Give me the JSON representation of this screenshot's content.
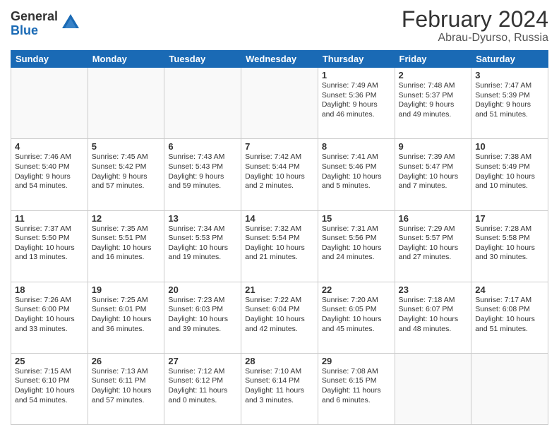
{
  "logo": {
    "general": "General",
    "blue": "Blue"
  },
  "header": {
    "title": "February 2024",
    "subtitle": "Abrau-Dyurso, Russia"
  },
  "weekdays": [
    "Sunday",
    "Monday",
    "Tuesday",
    "Wednesday",
    "Thursday",
    "Friday",
    "Saturday"
  ],
  "weeks": [
    [
      {
        "day": "",
        "lines": []
      },
      {
        "day": "",
        "lines": []
      },
      {
        "day": "",
        "lines": []
      },
      {
        "day": "",
        "lines": []
      },
      {
        "day": "1",
        "lines": [
          "Sunrise: 7:49 AM",
          "Sunset: 5:36 PM",
          "Daylight: 9 hours",
          "and 46 minutes."
        ]
      },
      {
        "day": "2",
        "lines": [
          "Sunrise: 7:48 AM",
          "Sunset: 5:37 PM",
          "Daylight: 9 hours",
          "and 49 minutes."
        ]
      },
      {
        "day": "3",
        "lines": [
          "Sunrise: 7:47 AM",
          "Sunset: 5:39 PM",
          "Daylight: 9 hours",
          "and 51 minutes."
        ]
      }
    ],
    [
      {
        "day": "4",
        "lines": [
          "Sunrise: 7:46 AM",
          "Sunset: 5:40 PM",
          "Daylight: 9 hours",
          "and 54 minutes."
        ]
      },
      {
        "day": "5",
        "lines": [
          "Sunrise: 7:45 AM",
          "Sunset: 5:42 PM",
          "Daylight: 9 hours",
          "and 57 minutes."
        ]
      },
      {
        "day": "6",
        "lines": [
          "Sunrise: 7:43 AM",
          "Sunset: 5:43 PM",
          "Daylight: 9 hours",
          "and 59 minutes."
        ]
      },
      {
        "day": "7",
        "lines": [
          "Sunrise: 7:42 AM",
          "Sunset: 5:44 PM",
          "Daylight: 10 hours",
          "and 2 minutes."
        ]
      },
      {
        "day": "8",
        "lines": [
          "Sunrise: 7:41 AM",
          "Sunset: 5:46 PM",
          "Daylight: 10 hours",
          "and 5 minutes."
        ]
      },
      {
        "day": "9",
        "lines": [
          "Sunrise: 7:39 AM",
          "Sunset: 5:47 PM",
          "Daylight: 10 hours",
          "and 7 minutes."
        ]
      },
      {
        "day": "10",
        "lines": [
          "Sunrise: 7:38 AM",
          "Sunset: 5:49 PM",
          "Daylight: 10 hours",
          "and 10 minutes."
        ]
      }
    ],
    [
      {
        "day": "11",
        "lines": [
          "Sunrise: 7:37 AM",
          "Sunset: 5:50 PM",
          "Daylight: 10 hours",
          "and 13 minutes."
        ]
      },
      {
        "day": "12",
        "lines": [
          "Sunrise: 7:35 AM",
          "Sunset: 5:51 PM",
          "Daylight: 10 hours",
          "and 16 minutes."
        ]
      },
      {
        "day": "13",
        "lines": [
          "Sunrise: 7:34 AM",
          "Sunset: 5:53 PM",
          "Daylight: 10 hours",
          "and 19 minutes."
        ]
      },
      {
        "day": "14",
        "lines": [
          "Sunrise: 7:32 AM",
          "Sunset: 5:54 PM",
          "Daylight: 10 hours",
          "and 21 minutes."
        ]
      },
      {
        "day": "15",
        "lines": [
          "Sunrise: 7:31 AM",
          "Sunset: 5:56 PM",
          "Daylight: 10 hours",
          "and 24 minutes."
        ]
      },
      {
        "day": "16",
        "lines": [
          "Sunrise: 7:29 AM",
          "Sunset: 5:57 PM",
          "Daylight: 10 hours",
          "and 27 minutes."
        ]
      },
      {
        "day": "17",
        "lines": [
          "Sunrise: 7:28 AM",
          "Sunset: 5:58 PM",
          "Daylight: 10 hours",
          "and 30 minutes."
        ]
      }
    ],
    [
      {
        "day": "18",
        "lines": [
          "Sunrise: 7:26 AM",
          "Sunset: 6:00 PM",
          "Daylight: 10 hours",
          "and 33 minutes."
        ]
      },
      {
        "day": "19",
        "lines": [
          "Sunrise: 7:25 AM",
          "Sunset: 6:01 PM",
          "Daylight: 10 hours",
          "and 36 minutes."
        ]
      },
      {
        "day": "20",
        "lines": [
          "Sunrise: 7:23 AM",
          "Sunset: 6:03 PM",
          "Daylight: 10 hours",
          "and 39 minutes."
        ]
      },
      {
        "day": "21",
        "lines": [
          "Sunrise: 7:22 AM",
          "Sunset: 6:04 PM",
          "Daylight: 10 hours",
          "and 42 minutes."
        ]
      },
      {
        "day": "22",
        "lines": [
          "Sunrise: 7:20 AM",
          "Sunset: 6:05 PM",
          "Daylight: 10 hours",
          "and 45 minutes."
        ]
      },
      {
        "day": "23",
        "lines": [
          "Sunrise: 7:18 AM",
          "Sunset: 6:07 PM",
          "Daylight: 10 hours",
          "and 48 minutes."
        ]
      },
      {
        "day": "24",
        "lines": [
          "Sunrise: 7:17 AM",
          "Sunset: 6:08 PM",
          "Daylight: 10 hours",
          "and 51 minutes."
        ]
      }
    ],
    [
      {
        "day": "25",
        "lines": [
          "Sunrise: 7:15 AM",
          "Sunset: 6:10 PM",
          "Daylight: 10 hours",
          "and 54 minutes."
        ]
      },
      {
        "day": "26",
        "lines": [
          "Sunrise: 7:13 AM",
          "Sunset: 6:11 PM",
          "Daylight: 10 hours",
          "and 57 minutes."
        ]
      },
      {
        "day": "27",
        "lines": [
          "Sunrise: 7:12 AM",
          "Sunset: 6:12 PM",
          "Daylight: 11 hours",
          "and 0 minutes."
        ]
      },
      {
        "day": "28",
        "lines": [
          "Sunrise: 7:10 AM",
          "Sunset: 6:14 PM",
          "Daylight: 11 hours",
          "and 3 minutes."
        ]
      },
      {
        "day": "29",
        "lines": [
          "Sunrise: 7:08 AM",
          "Sunset: 6:15 PM",
          "Daylight: 11 hours",
          "and 6 minutes."
        ]
      },
      {
        "day": "",
        "lines": []
      },
      {
        "day": "",
        "lines": []
      }
    ]
  ]
}
